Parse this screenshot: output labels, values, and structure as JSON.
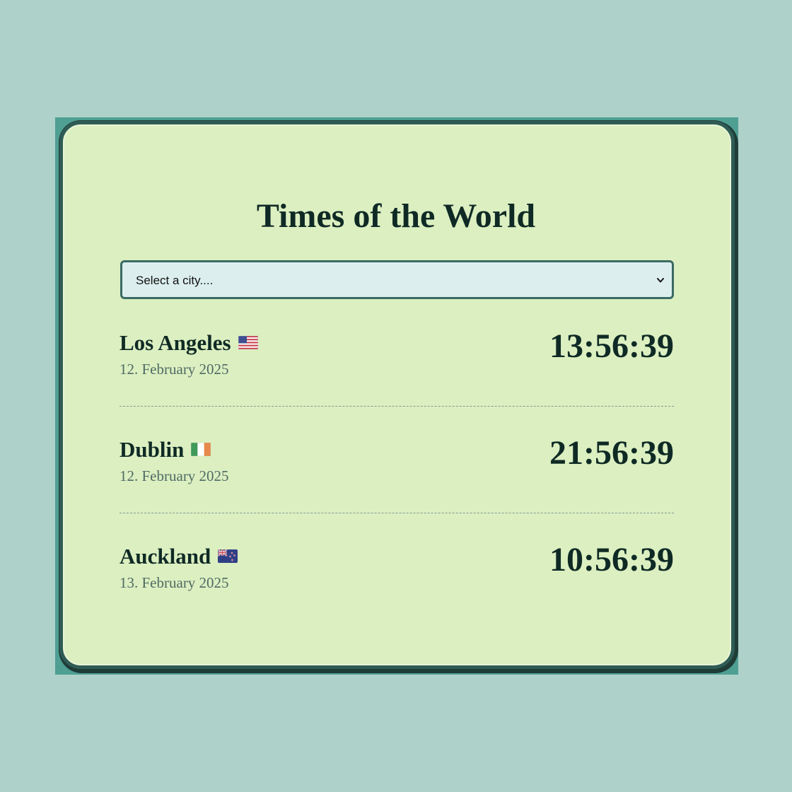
{
  "app": {
    "title": "Times of the World"
  },
  "city_select": {
    "value": "Select a city...."
  },
  "clocks": [
    {
      "city": "Los Angeles",
      "flag": "us-flag-icon",
      "date": "12. February 2025",
      "time": "13:56:39"
    },
    {
      "city": "Dublin",
      "flag": "ireland-flag-icon",
      "date": "12. February 2025",
      "time": "21:56:39"
    },
    {
      "city": "Auckland",
      "flag": "new-zealand-flag-icon",
      "date": "13. February 2025",
      "time": "10:56:39"
    }
  ],
  "colors": {
    "background": "#aed1ca",
    "card": "#dcefc1",
    "card_border": "#2f5c55",
    "text": "#0f2a25",
    "muted_text": "#4f6b64",
    "select_background": "#dcefee"
  }
}
